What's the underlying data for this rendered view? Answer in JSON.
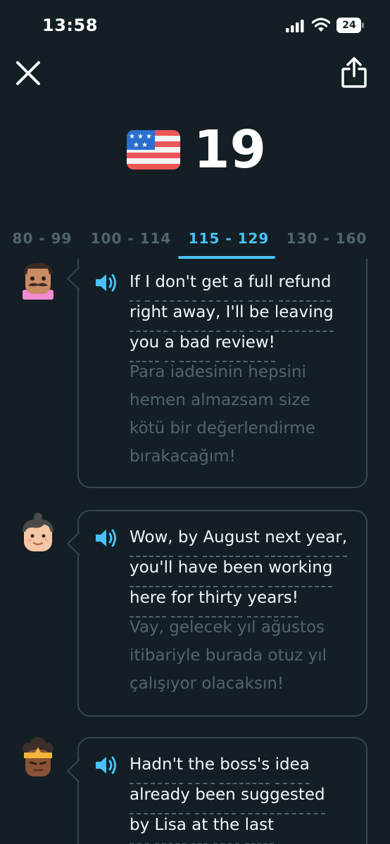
{
  "status_bar": {
    "time": "13:58",
    "battery": "24"
  },
  "header": {
    "streak_count": "19"
  },
  "tabs": [
    {
      "label": "80 - 99",
      "active": false
    },
    {
      "label": "100 - 114",
      "active": false
    },
    {
      "label": "115 - 129",
      "active": true
    },
    {
      "label": "130 - 160",
      "active": false
    }
  ],
  "messages": [
    {
      "lines": [
        [
          "If",
          "I",
          "don't",
          "get",
          "a",
          "full",
          "refund"
        ],
        [
          "right",
          "away,",
          "I'll",
          "be",
          "leaving"
        ],
        [
          "you",
          "a",
          "bad",
          "review!"
        ]
      ],
      "translation": [
        "Para iadesinin hepsini",
        "hemen almazsam size",
        "kötü bir değerlendirme",
        "bırakacağım!"
      ]
    },
    {
      "lines": [
        [
          "Wow,",
          "by",
          "August",
          "next",
          "year,"
        ],
        [
          "you'll",
          "have",
          "been",
          "working"
        ],
        [
          "here",
          "for",
          "thirty",
          "years!"
        ]
      ],
      "translation": [
        "Vay, gelecek yıl ağustos",
        "itibariyle burada otuz yıl",
        "çalışıyor olacaksın!"
      ]
    },
    {
      "lines": [
        [
          "Hadn't",
          "the",
          "boss's",
          "idea"
        ],
        [
          "already",
          "been",
          "suggested"
        ],
        [
          "by",
          "Lisa",
          "at",
          "the",
          "last"
        ]
      ],
      "translation": []
    }
  ],
  "colors": {
    "background": "#131f24",
    "accent": "#49c0f8",
    "border": "#37464f",
    "muted": "#52656d"
  },
  "icons": [
    "close-icon",
    "share-icon",
    "us-flag-icon",
    "speaker-icon",
    "signal-icon",
    "wifi-icon",
    "battery-icon"
  ]
}
